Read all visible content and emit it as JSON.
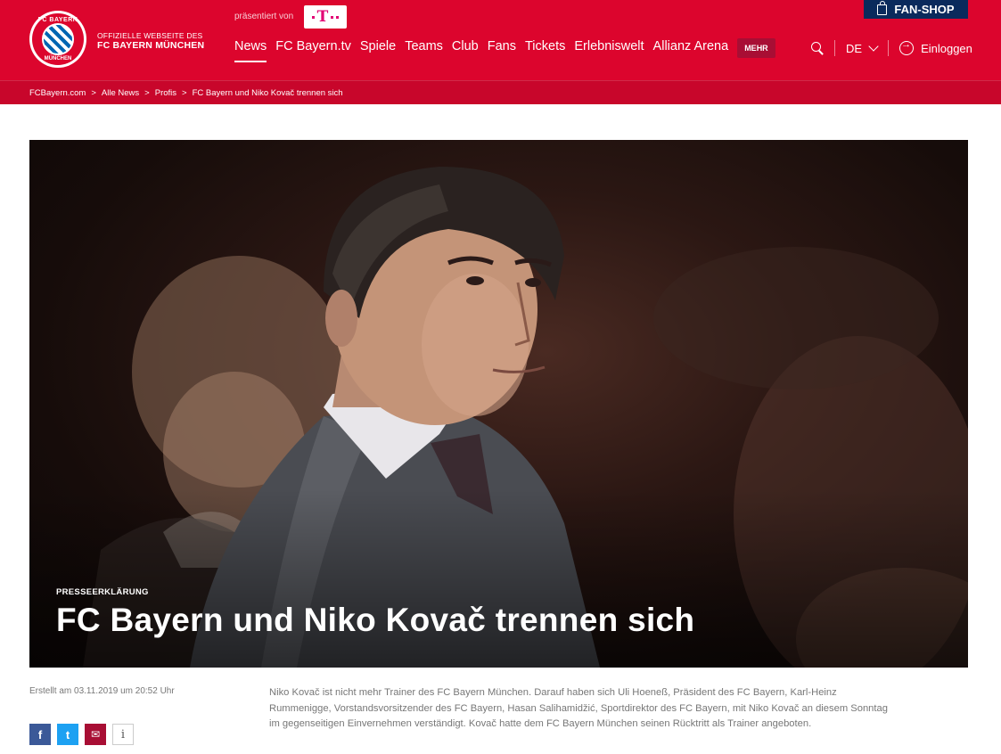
{
  "header": {
    "site_tag_line1": "OFFIZIELLE WEBSEITE DES",
    "site_tag_line2": "FC BAYERN MÜNCHEN",
    "logo_top": "FC BAYERN",
    "logo_bottom": "MÜNCHEN",
    "presented_by": "präsentiert von",
    "sponsor_logo": "telekom-t-logo",
    "fanshop_label": "FAN-SHOP",
    "nav": [
      {
        "label": "News",
        "active": true
      },
      {
        "label": "FC Bayern.tv"
      },
      {
        "label": "Spiele"
      },
      {
        "label": "Teams"
      },
      {
        "label": "Club"
      },
      {
        "label": "Fans"
      },
      {
        "label": "Tickets"
      },
      {
        "label": "Erlebniswelt"
      },
      {
        "label": "Allianz Arena"
      }
    ],
    "more_label": "MEHR",
    "language": "DE",
    "login_label": "Einloggen"
  },
  "breadcrumb": [
    "FCBayern.com",
    "Alle News",
    "Profis",
    "FC Bayern und Niko Kovač trennen sich"
  ],
  "breadcrumb_separator": ">",
  "article": {
    "kicker": "PRESSEERKLÄRUNG",
    "headline": "FC Bayern und Niko Kovač trennen sich",
    "created": "Erstellt am 03.11.2019 um 20:52 Uhr",
    "body": "Niko Kovač ist nicht mehr Trainer des FC Bayern München. Darauf haben sich Uli Hoeneß, Präsident des FC Bayern, Karl-Heinz Rummenigge, Vorstandsvorsitzender des FC Bayern, Hasan Salihamidžić, Sportdirektor des FC Bayern, mit Niko Kovač an diesem Sonntag im gegenseitigen Einvernehmen verständigt. Kovač hatte dem FC Bayern München seinen Rücktritt als Trainer angeboten."
  },
  "share": {
    "facebook": "f",
    "twitter": "t",
    "mail": "✉",
    "info": "i"
  },
  "colors": {
    "brand_red": "#dc052d",
    "breadcrumb_red": "#c8062b",
    "fanshop_navy": "#0a2a5c",
    "mehr_bg": "#a80e34"
  }
}
